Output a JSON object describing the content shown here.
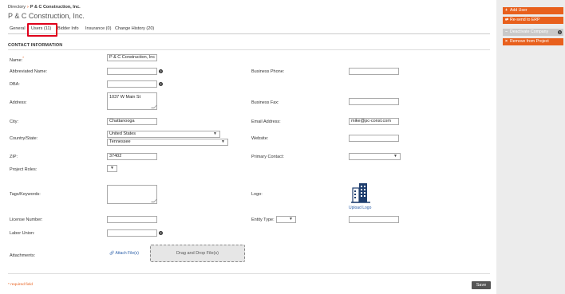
{
  "breadcrumb": {
    "root": "Directory",
    "current": "P & C Construction, Inc."
  },
  "page_title": "P & C Construction, Inc.",
  "tabs": [
    "General",
    "Users (11)",
    "Bidder Info",
    "Insurance (0)",
    "Change History (20)"
  ],
  "active_tab": "Users (11)",
  "section_title": "CONTACT INFORMATION",
  "labels": {
    "name": "Name:",
    "required_mark": "*",
    "abbreviated_name": "Abbreviated Name:",
    "dba": "DBA:",
    "address": "Address:",
    "city": "City:",
    "country_state": "Country/State:",
    "zip": "ZIP:",
    "project_roles": "Project Roles:",
    "tags_keywords": "Tags/Keywords:",
    "license_number": "License Number:",
    "labor_union": "Labor Union:",
    "attachments": "Attachments:",
    "business_phone": "Business Phone:",
    "business_fax": "Business Fax:",
    "email_address": "Email Address:",
    "website": "Website:",
    "primary_contact": "Primary Contact:",
    "logo": "Logo:",
    "entity_type": "Entity Type:"
  },
  "values": {
    "name": "P & C Construction, Inc",
    "abbreviated_name": "",
    "dba": "",
    "address": "1037 W Main St",
    "city": "Chattanooga",
    "country": "United States",
    "state": "Tennessee",
    "zip": "37402",
    "project_roles": "",
    "tags_keywords": "",
    "license_number": "",
    "labor_union": "",
    "business_phone": "",
    "business_fax": "",
    "email_address": "mike@pc-const.com",
    "website": "",
    "primary_contact": "",
    "entity_type": "",
    "entity_type_extra": ""
  },
  "upload_logo": "Upload Logo",
  "attach_files": "Attach File(s)",
  "drop_files": "Drag and Drop File(s)",
  "required_note": "* required field",
  "save_label": "Save",
  "sidebar": [
    {
      "icon": "+",
      "label": "Add User",
      "disabled": false
    },
    {
      "icon": "⇄",
      "label": "Re-send to ERP",
      "disabled": false
    },
    {
      "icon": "−",
      "label": "Deactivate Company",
      "disabled": true,
      "help": true
    },
    {
      "icon": "×",
      "label": "Remove from Project",
      "disabled": false
    }
  ],
  "colors": {
    "accent": "#e8601d",
    "highlight": "#e0001b",
    "link": "#2a5ea8"
  }
}
